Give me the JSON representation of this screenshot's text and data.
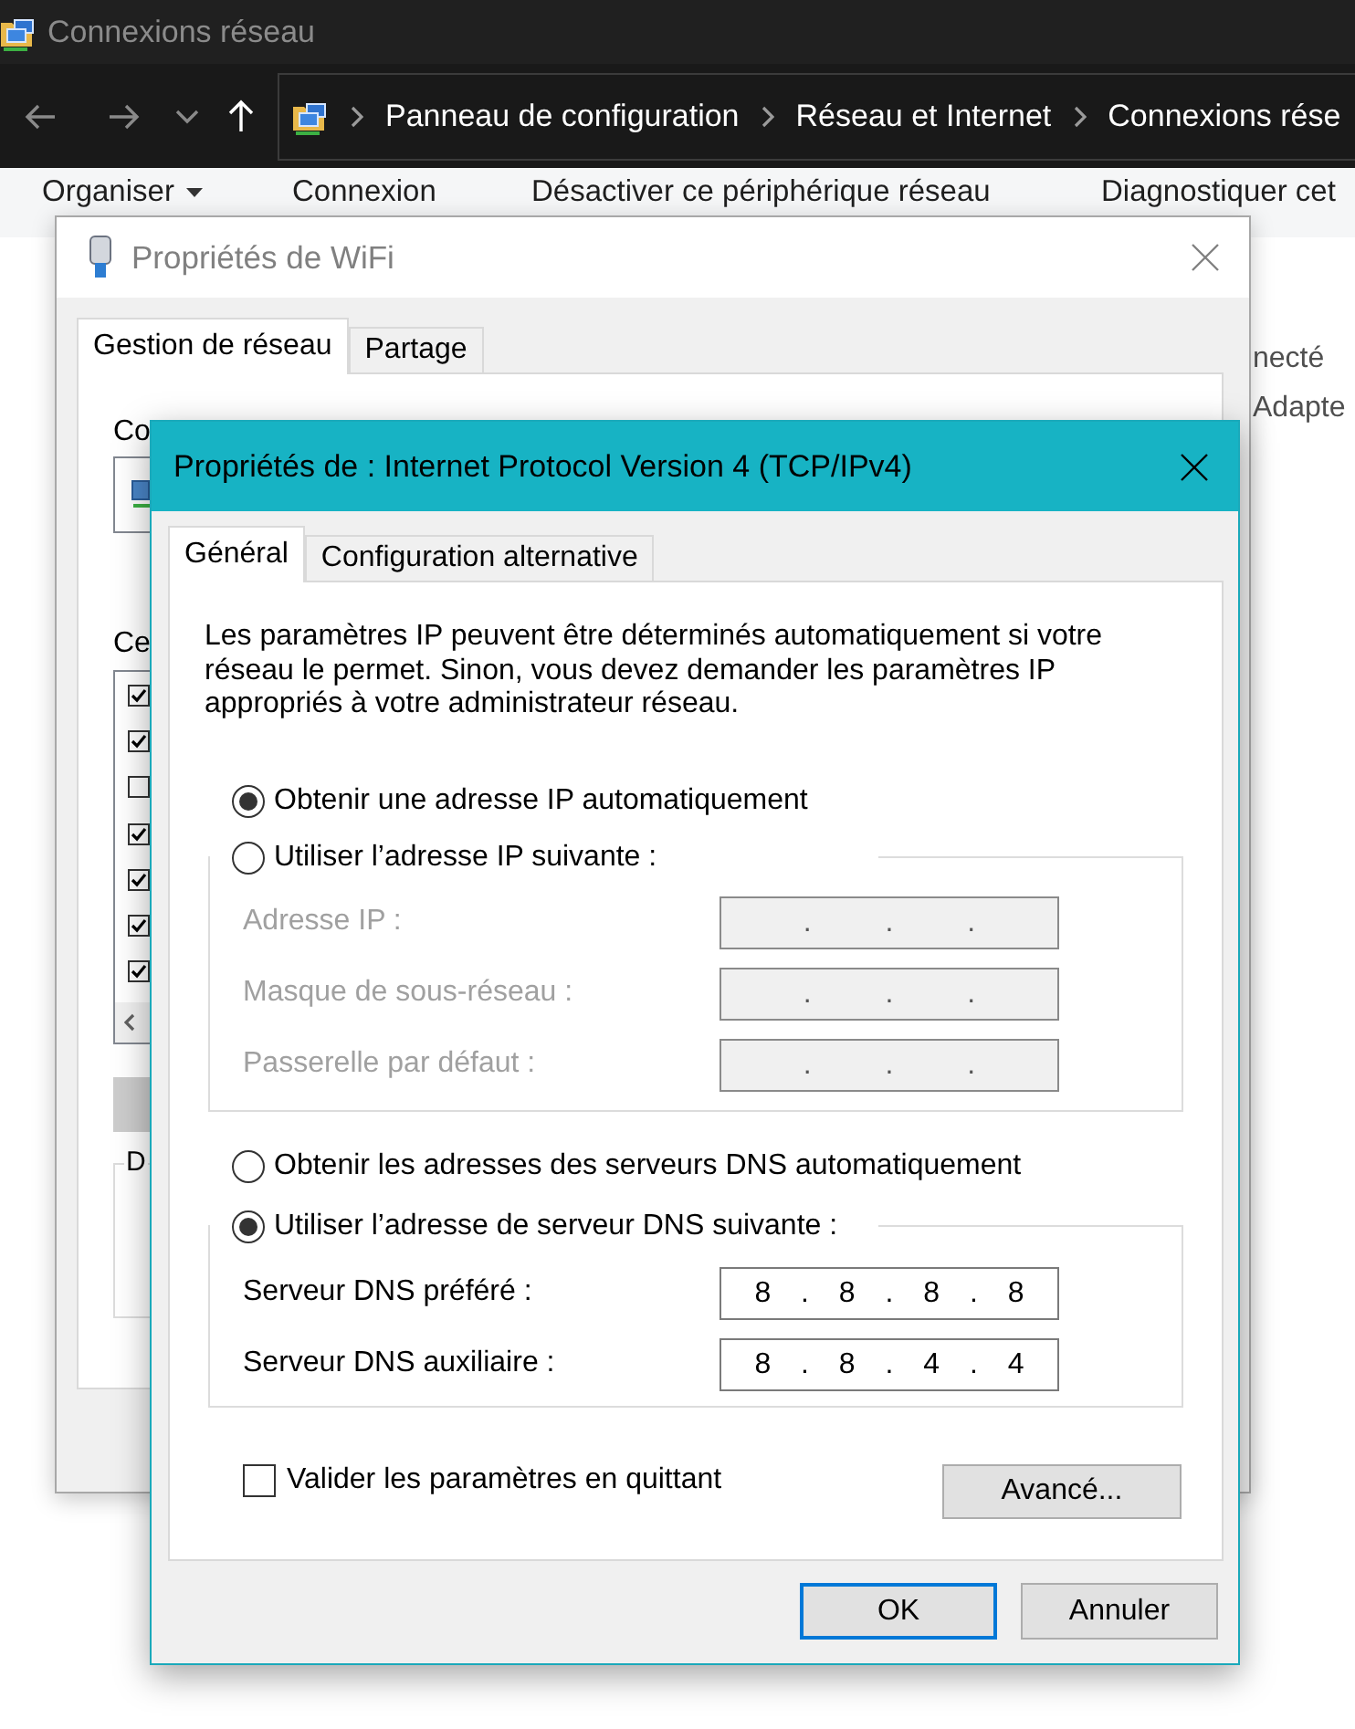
{
  "explorer": {
    "title": "Connexions réseau",
    "nav_buttons": [
      {
        "kind": "back",
        "disabled": true
      },
      {
        "kind": "forward",
        "disabled": true
      },
      {
        "kind": "history",
        "disabled": true
      },
      {
        "kind": "up",
        "disabled": false
      }
    ],
    "breadcrumb": [
      "Panneau de configuration",
      "Réseau et Internet",
      "Connexions rése"
    ],
    "toolbar": [
      {
        "label": "Organiser",
        "menu": true
      },
      {
        "label": "Connexion",
        "menu": false
      },
      {
        "label": "Désactiver ce périphérique réseau",
        "menu": false
      },
      {
        "label": "Diagnostiquer cet",
        "menu": false
      }
    ],
    "details": [
      "necté",
      "Adapte"
    ]
  },
  "wifi_dialog": {
    "title": "Propriétés de WiFi",
    "active": false,
    "tabs": [
      {
        "label": "Gestion de réseau",
        "selected": true
      },
      {
        "label": "Partage",
        "selected": false
      }
    ],
    "connection_label": "Co",
    "components_label": "Ce",
    "components": [
      {
        "checked": true
      },
      {
        "checked": true
      },
      {
        "checked": false
      },
      {
        "checked": true
      },
      {
        "checked": true
      },
      {
        "checked": true
      },
      {
        "checked": true
      }
    ],
    "description_label": "D"
  },
  "ipv4_dialog": {
    "title": "Propriétés de : Internet Protocol Version 4 (TCP/IPv4)",
    "active": true,
    "tabs": [
      {
        "label": "Général",
        "selected": true
      },
      {
        "label": "Configuration alternative",
        "selected": false
      }
    ],
    "intro": "Les paramètres IP peuvent être déterminés automatiquement si votre réseau le permet. Sinon, vous devez demander les paramètres IP appropriés à votre administrateur réseau.",
    "ip_section": {
      "auto_option": {
        "label": "Obtenir une adresse IP automatiquement",
        "selected": true
      },
      "manual_option": {
        "label": "Utiliser l’adresse IP suivante :",
        "selected": false
      },
      "fields": [
        {
          "label": "Adresse IP :",
          "value": ". . .",
          "disabled": true
        },
        {
          "label": "Masque de sous-réseau :",
          "value": ". . .",
          "disabled": true
        },
        {
          "label": "Passerelle par défaut :",
          "value": ". . .",
          "disabled": true
        }
      ]
    },
    "dns_section": {
      "auto_option": {
        "label": "Obtenir les adresses des serveurs DNS automatiquement",
        "selected": false
      },
      "manual_option": {
        "label": "Utiliser l’adresse de serveur DNS suivante :",
        "selected": true
      },
      "fields": [
        {
          "label": "Serveur DNS préféré :",
          "value": "8 . 8 . 8 . 8",
          "disabled": false
        },
        {
          "label": "Serveur DNS auxiliaire :",
          "value": "8 . 8 . 4 . 4",
          "disabled": false
        }
      ]
    },
    "validate_on_exit": {
      "label": "Valider les paramètres en quittant",
      "checked": false
    },
    "advanced_button": "Avancé...",
    "buttons": [
      {
        "label": "OK",
        "default": true
      },
      {
        "label": "Annuler",
        "default": false
      }
    ]
  }
}
